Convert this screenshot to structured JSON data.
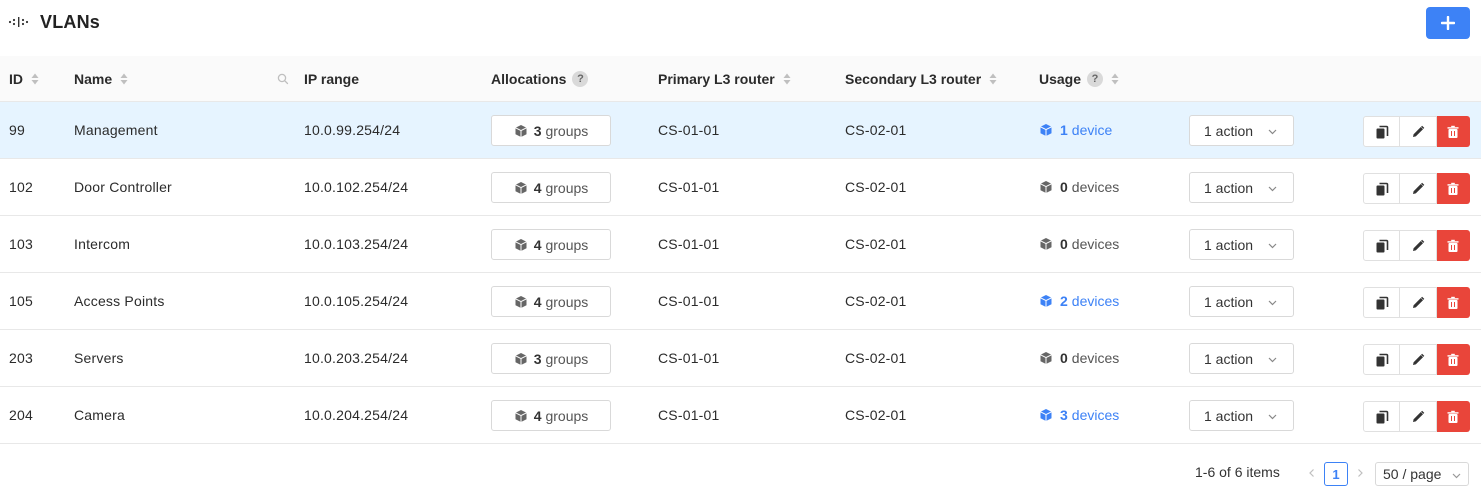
{
  "header": {
    "title": "VLANs",
    "add_label": "+"
  },
  "table": {
    "columns": {
      "id": "ID",
      "name": "Name",
      "ip_range": "IP range",
      "allocations": "Allocations",
      "primary": "Primary L3 router",
      "secondary": "Secondary L3 router",
      "usage": "Usage",
      "help": "?"
    },
    "rows": [
      {
        "id": "99",
        "name": "Management",
        "ip": "10.0.99.254/24",
        "groups_count": "3",
        "groups_word": "groups",
        "primary": "CS-01-01",
        "secondary": "CS-02-01",
        "usage_count": "1",
        "usage_word": "device",
        "usage_active": true,
        "action": "1 action"
      },
      {
        "id": "102",
        "name": "Door Controller",
        "ip": "10.0.102.254/24",
        "groups_count": "4",
        "groups_word": "groups",
        "primary": "CS-01-01",
        "secondary": "CS-02-01",
        "usage_count": "0",
        "usage_word": "devices",
        "usage_active": false,
        "action": "1 action"
      },
      {
        "id": "103",
        "name": "Intercom",
        "ip": "10.0.103.254/24",
        "groups_count": "4",
        "groups_word": "groups",
        "primary": "CS-01-01",
        "secondary": "CS-02-01",
        "usage_count": "0",
        "usage_word": "devices",
        "usage_active": false,
        "action": "1 action"
      },
      {
        "id": "105",
        "name": "Access Points",
        "ip": "10.0.105.254/24",
        "groups_count": "4",
        "groups_word": "groups",
        "primary": "CS-01-01",
        "secondary": "CS-02-01",
        "usage_count": "2",
        "usage_word": "devices",
        "usage_active": true,
        "action": "1 action"
      },
      {
        "id": "203",
        "name": "Servers",
        "ip": "10.0.203.254/24",
        "groups_count": "3",
        "groups_word": "groups",
        "primary": "CS-01-01",
        "secondary": "CS-02-01",
        "usage_count": "0",
        "usage_word": "devices",
        "usage_active": false,
        "action": "1 action"
      },
      {
        "id": "204",
        "name": "Camera",
        "ip": "10.0.204.254/24",
        "groups_count": "4",
        "groups_word": "groups",
        "primary": "CS-01-01",
        "secondary": "CS-02-01",
        "usage_count": "3",
        "usage_word": "devices",
        "usage_active": true,
        "action": "1 action"
      }
    ]
  },
  "pagination": {
    "total_text": "1-6 of 6 items",
    "current_page": "1",
    "page_size": "50 / page"
  },
  "colors": {
    "accent": "#3d82f6",
    "danger": "#e9453a",
    "selected_row": "#e6f4ff"
  },
  "icons": [
    "vlan-icon",
    "plus-icon",
    "sort-icon",
    "search-icon",
    "cube-icon",
    "copy-icon",
    "edit-icon",
    "delete-icon",
    "chevron-down-icon",
    "chevron-left-icon",
    "chevron-right-icon"
  ]
}
